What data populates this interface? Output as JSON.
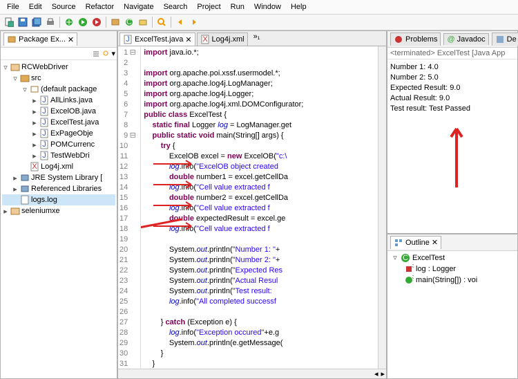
{
  "menu": [
    "File",
    "Edit",
    "Source",
    "Refactor",
    "Navigate",
    "Search",
    "Project",
    "Run",
    "Window",
    "Help"
  ],
  "package_explorer": {
    "tab": "Package Ex...",
    "projects": [
      "RCWebDriver",
      "seleniumxe"
    ],
    "src": "src",
    "default_pkg": "(default package",
    "files": [
      "AllLinks.java",
      "ExcelOB.java",
      "ExcelTest.java",
      "ExPageObje",
      "POMCurrenc",
      "TestWebDri"
    ],
    "log4j": "Log4j.xml",
    "jre": "JRE System Library [",
    "reflib": "Referenced Libraries",
    "logs": "logs.log"
  },
  "editor": {
    "tabs": [
      "ExcelTest.java",
      "Log4j.xml"
    ],
    "lines": [
      {
        "n": 1,
        "fold": "⊟",
        "html": "<span class='kw'>import</span> java.io.*;"
      },
      {
        "n": 2,
        "html": ""
      },
      {
        "n": 3,
        "html": "<span class='kw'>import</span> org.apache.poi.xssf.usermodel.*;"
      },
      {
        "n": 4,
        "html": "<span class='kw'>import</span> org.apache.log4j.LogManager;"
      },
      {
        "n": 5,
        "html": "<span class='kw'>import</span> org.apache.log4j.Logger;"
      },
      {
        "n": 6,
        "html": "<span class='kw'>import</span> org.apache.log4j.xml.DOMConfigurator;"
      },
      {
        "n": 7,
        "html": "<span class='kw'>public class</span> ExcelTest {"
      },
      {
        "n": 8,
        "html": "    <span class='kw'>static final</span> Logger <span class='field'>log</span> = LogManager.get"
      },
      {
        "n": 9,
        "fold": "⊟",
        "html": "    <span class='kw'>public static void</span> main(String[] args) {"
      },
      {
        "n": 10,
        "html": "        <span class='kw'>try</span> {"
      },
      {
        "n": 11,
        "html": "            ExcelOB excel = <span class='kw'>new</span> ExcelOB(<span class='str'>\"c:\\</span>"
      },
      {
        "n": 12,
        "html": "            <span class='field'>log</span>.info(<span class='str'>\"ExcelOB object created</span>"
      },
      {
        "n": 13,
        "html": "            <span class='kw'>double</span> number1 = excel.getCellDa"
      },
      {
        "n": 14,
        "html": "            <span class='field'>log</span>.info(<span class='str'>\"Cell value extracted f</span>"
      },
      {
        "n": 15,
        "html": "            <span class='kw'>double</span> number2 = excel.getCellDa"
      },
      {
        "n": 16,
        "html": "            <span class='field'>log</span>.info(<span class='str'>\"Cell value extracted f</span>"
      },
      {
        "n": 17,
        "html": "            <span class='kw'>double</span> expectedResult = excel.ge"
      },
      {
        "n": 18,
        "html": "            <span class='field'>log</span>.info(<span class='str'>\"Cell value extracted f</span>"
      },
      {
        "n": 19,
        "html": ""
      },
      {
        "n": 20,
        "html": "            System.<span class='field'>out</span>.println(<span class='str'>\"Number 1: \"</span>+"
      },
      {
        "n": 21,
        "html": "            System.<span class='field'>out</span>.println(<span class='str'>\"Number 2: \"</span>+"
      },
      {
        "n": 22,
        "html": "            System.<span class='field'>out</span>.println(<span class='str'>\"Expected Res</span>"
      },
      {
        "n": 23,
        "html": "            System.<span class='field'>out</span>.println(<span class='str'>\"Actual Resul</span>"
      },
      {
        "n": 24,
        "html": "            System.<span class='field'>out</span>.println(<span class='str'>\"Test result:</span>"
      },
      {
        "n": 25,
        "html": "            <span class='field'>log</span>.info(<span class='str'>\"All completed successf</span>"
      },
      {
        "n": 26,
        "html": ""
      },
      {
        "n": 27,
        "html": "        } <span class='kw'>catch</span> (Exception e) {"
      },
      {
        "n": 28,
        "html": "            <span class='field'>log</span>.info(<span class='str'>\"Exception occured\"</span>+e.g"
      },
      {
        "n": 29,
        "html": "            System.<span class='field'>out</span>.println(e.getMessage("
      },
      {
        "n": 30,
        "html": "        }"
      },
      {
        "n": 31,
        "html": "    }"
      }
    ]
  },
  "right": {
    "tabs": [
      "Problems",
      "Javadoc",
      "De"
    ],
    "terminated": "<terminated> ExcelTest [Java App",
    "console": [
      "Number 1: 4.0",
      "Number 2: 5.0",
      "Expected Result: 9.0",
      "Actual Result: 9.0",
      "Test result: Test Passed"
    ],
    "outline_tab": "Outline",
    "outline": {
      "class": "ExcelTest",
      "log": "log : Logger",
      "main": "main(String[]) : voi"
    }
  }
}
